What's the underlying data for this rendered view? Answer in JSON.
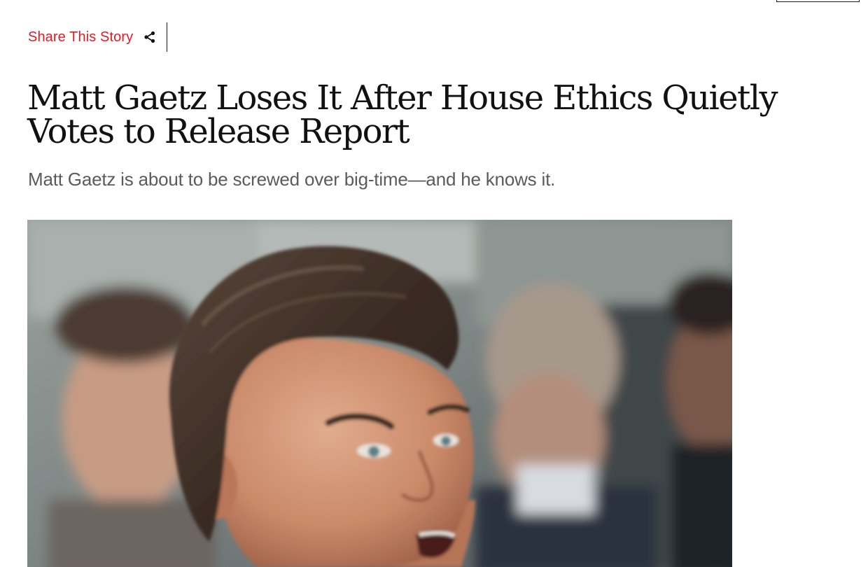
{
  "share": {
    "label": "Share This Story",
    "icon": "share-icon",
    "accent_color": "#e21b23"
  },
  "article": {
    "headline": "Matt Gaetz Loses It After House Ethics Quietly Votes to Release Report",
    "dek": "Matt Gaetz is about to be screwed over big-time—and he knows it."
  },
  "image": {
    "alt": "Matt Gaetz speaking, surrounded by people"
  }
}
